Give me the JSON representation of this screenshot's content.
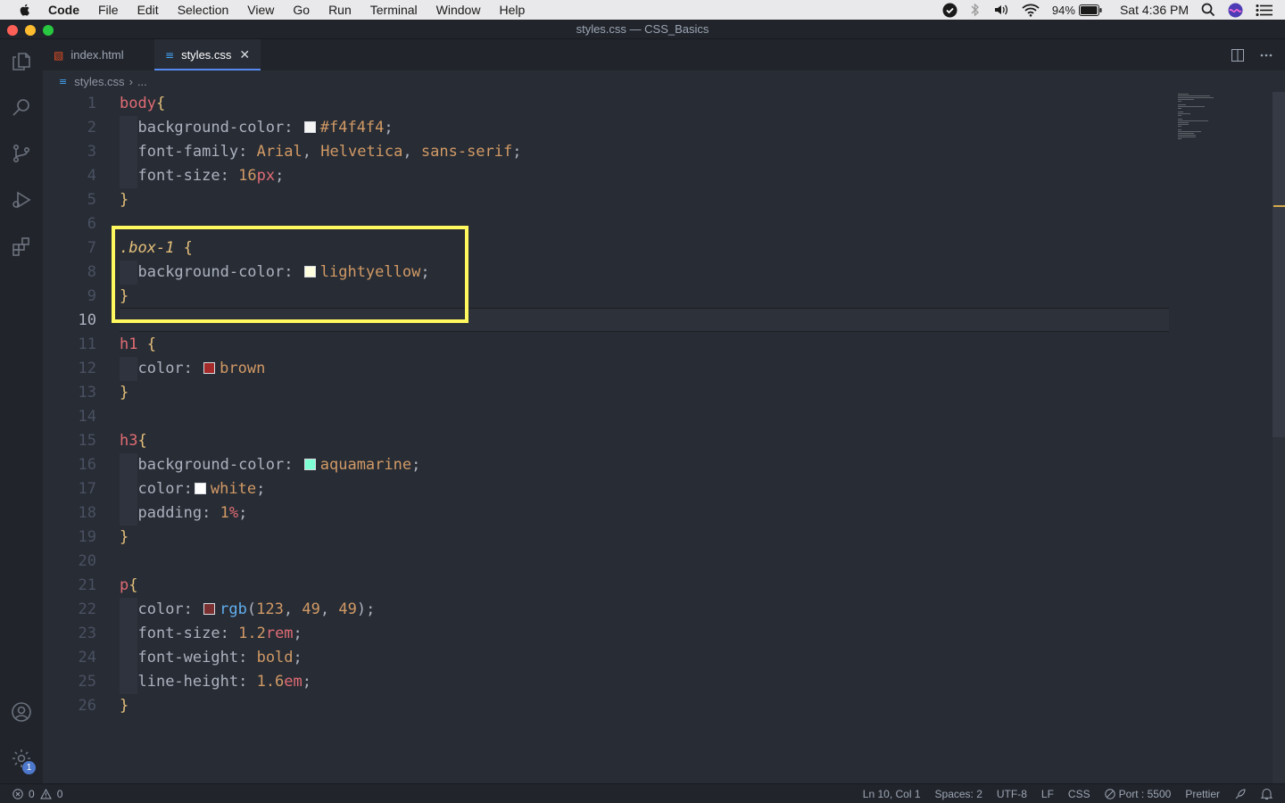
{
  "menubar": {
    "app": "Code",
    "items": [
      "File",
      "Edit",
      "Selection",
      "View",
      "Go",
      "Run",
      "Terminal",
      "Window",
      "Help"
    ],
    "battery": "94%",
    "clock": "Sat 4:36 PM"
  },
  "window": {
    "title": "styles.css — CSS_Basics"
  },
  "tabs": [
    {
      "label": "index.html",
      "icon": "html-file-icon"
    },
    {
      "label": "styles.css",
      "icon": "css-file-icon",
      "active": true
    }
  ],
  "breadcrumb": {
    "file": "styles.css",
    "more": "..."
  },
  "activity_badge": "1",
  "statusbar": {
    "errors": "0",
    "warnings": "0",
    "position": "Ln 10, Col 1",
    "spaces": "Spaces: 2",
    "encoding": "UTF-8",
    "eol": "LF",
    "language": "CSS",
    "port": "Port : 5500",
    "formatter": "Prettier"
  },
  "code": {
    "line_numbers": [
      "1",
      "2",
      "3",
      "4",
      "5",
      "6",
      "7",
      "8",
      "9",
      "10",
      "11",
      "12",
      "13",
      "14",
      "15",
      "16",
      "17",
      "18",
      "19",
      "20",
      "21",
      "22",
      "23",
      "24",
      "25",
      "26"
    ],
    "lines": [
      "body{",
      "  background-color: #f4f4f4;",
      "  font-family: Arial, Helvetica, sans-serif;",
      "  font-size: 16px;",
      "}",
      "",
      ".box-1 {",
      "  background-color: lightyellow;",
      "}",
      "",
      "h1 {",
      "  color: brown",
      "}",
      "",
      "h3{",
      "  background-color: aquamarine;",
      "  color:white;",
      "  padding: 1%;",
      "}",
      "",
      "p{",
      "  color: rgb(123, 49, 49);",
      "  font-size: 1.2rem;",
      "  font-weight: bold;",
      "  line-height: 1.6em;",
      "}"
    ]
  },
  "colors": {
    "f4f4f4": "#f4f4f4",
    "lightyellow": "#ffffe0",
    "brown": "#a52a2a",
    "aquamarine": "#7fffd4",
    "white": "#ffffff",
    "rgb": "#7b3131",
    "highlight": "#fff85e"
  }
}
